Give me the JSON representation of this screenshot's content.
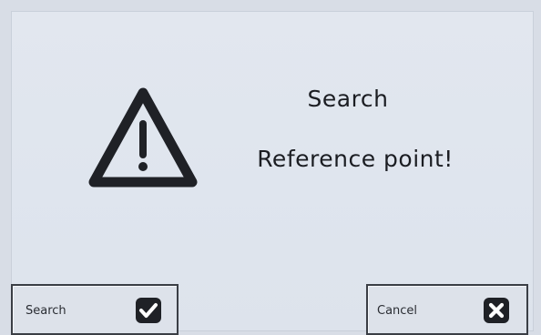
{
  "message": {
    "title": "Search",
    "text": "Reference point!"
  },
  "buttons": {
    "search_label": "Search",
    "cancel_label": "Cancel"
  },
  "icons": {
    "warning": "warning-triangle-icon",
    "confirm": "checkmark-icon",
    "cancel": "x-icon"
  },
  "colors": {
    "background": "#dfe5ee",
    "text": "#1b1d22",
    "icon": "#1f2126"
  }
}
